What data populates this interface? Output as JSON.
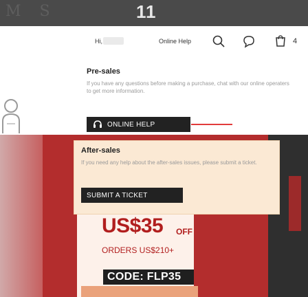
{
  "topbar": {
    "brand": "M S",
    "center_text": "11"
  },
  "header": {
    "greeting": "Hi,",
    "online_help": "Online Help",
    "icons": [
      "search-icon",
      "chat-icon",
      "cart-icon"
    ],
    "cart_count": "4"
  },
  "pre_sales": {
    "title": "Pre-sales",
    "description": "If you have any questions before making a purchase, chat with our online operaters to get more information.",
    "button_label": "ONLINE HELP"
  },
  "after_sales": {
    "title": "After-sales",
    "description": "If you need any help about the after-sales issues, please submit a ticket.",
    "button_label": "SUBMIT A TICKET"
  },
  "coupon": {
    "amount": "US$35",
    "off_label": "OFF",
    "orders_label": "ORDERS US$210+",
    "code_label": "CODE: FLP35"
  },
  "colors": {
    "accent_red": "#b11e1e",
    "button_dark": "#222222",
    "panel_bg": "#fbe9d4",
    "pointer_red": "#e23b3b"
  }
}
